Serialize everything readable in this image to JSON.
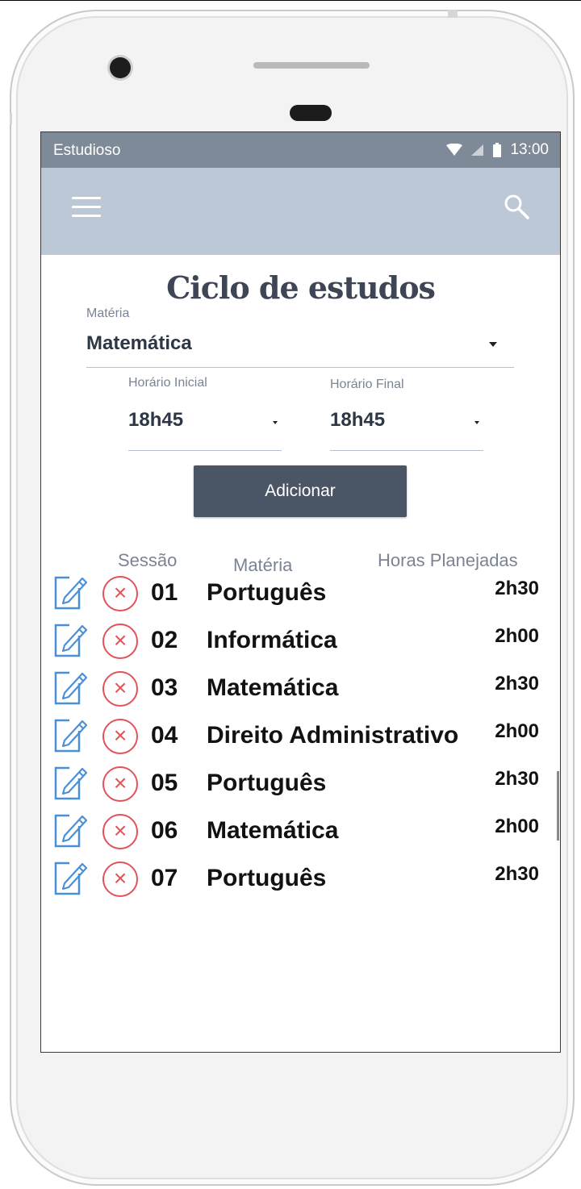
{
  "status_bar": {
    "app_name": "Estudioso",
    "time": "13:00"
  },
  "app_bar": {
    "menu_icon": "hamburger-icon",
    "search_icon": "search-icon"
  },
  "page_title": "Ciclo de estudos",
  "subject_field": {
    "label": "Matéria",
    "value": "Matemática"
  },
  "start_time_field": {
    "label": "Horário Inicial",
    "value": "18h45"
  },
  "end_time_field": {
    "label": "Horário Final",
    "value": "18h45"
  },
  "add_button": {
    "label": "Adicionar"
  },
  "table": {
    "headers": {
      "session": "Sessão",
      "subject": "Matéria",
      "hours": "Horas Planejadas"
    },
    "rows": [
      {
        "session": "01",
        "subject": "Português",
        "hours": "2h30"
      },
      {
        "session": "02",
        "subject": "Informática",
        "hours": "2h00"
      },
      {
        "session": "03",
        "subject": "Matemática",
        "hours": "2h30"
      },
      {
        "session": "04",
        "subject": "Direito Administrativo",
        "hours": "2h00"
      },
      {
        "session": "05",
        "subject": "Português",
        "hours": "2h30"
      },
      {
        "session": "06",
        "subject": "Matemática",
        "hours": "2h00"
      },
      {
        "session": "07",
        "subject": "Português",
        "hours": "2h30"
      }
    ]
  },
  "colors": {
    "status_bar": "#7f8a99",
    "app_bar": "#bdc8d6",
    "button": "#4a5666",
    "delete": "#e2525a",
    "edit": "#4a90d9"
  }
}
